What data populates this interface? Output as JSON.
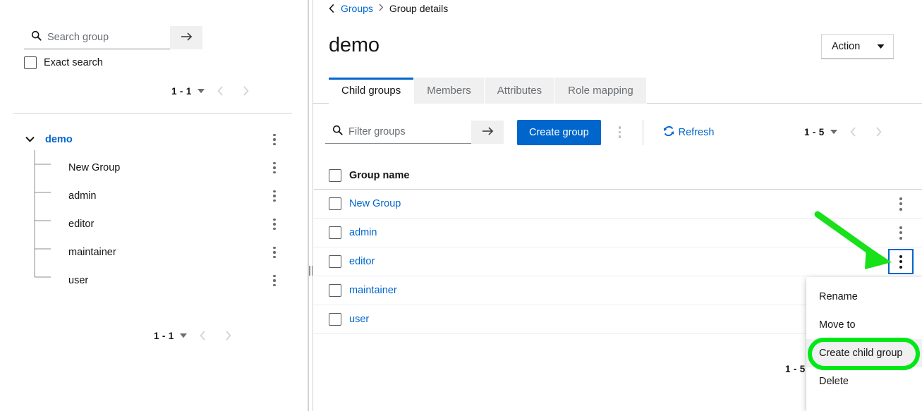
{
  "left_panel": {
    "search": {
      "placeholder": "Search group",
      "value": "",
      "go_label": "→",
      "icon": "search-icon"
    },
    "exact_search": {
      "label": "Exact search",
      "checked": false
    },
    "pager_top": {
      "count": "1 - 1"
    },
    "pager_bottom": {
      "count": "1 - 1"
    },
    "tree": [
      {
        "label": "demo",
        "level": 0,
        "expanded": true,
        "selected": true
      },
      {
        "label": "New Group",
        "level": 1
      },
      {
        "label": "admin",
        "level": 1
      },
      {
        "label": "editor",
        "level": 1
      },
      {
        "label": "maintainer",
        "level": 1
      },
      {
        "label": "user",
        "level": 1
      }
    ]
  },
  "right_panel": {
    "breadcrumb": {
      "back": "‹",
      "root": "Groups",
      "separator": "›",
      "current": "Group details"
    },
    "title": "demo",
    "action_button": {
      "label": "Action",
      "caret": "▼"
    },
    "tabs": [
      {
        "label": "Child groups",
        "active": true
      },
      {
        "label": "Members",
        "active": false
      },
      {
        "label": "Attributes",
        "active": false
      },
      {
        "label": "Role mapping",
        "active": false
      }
    ],
    "toolbar": {
      "filter": {
        "placeholder": "Filter groups",
        "value": "",
        "go_label": "→"
      },
      "create_group_label": "Create group",
      "refresh_label": "Refresh",
      "pager": {
        "count": "1 - 5"
      }
    },
    "table": {
      "columns": [
        "Group name"
      ],
      "rows": [
        {
          "name": "New Group"
        },
        {
          "name": "admin"
        },
        {
          "name": "editor"
        },
        {
          "name": "maintainer"
        },
        {
          "name": "user"
        }
      ]
    },
    "bottom_pager": {
      "count": "1 - 5"
    },
    "row_menu": {
      "open_for_row": "editor",
      "items": [
        {
          "label": "Rename",
          "hover": false
        },
        {
          "label": "Move to",
          "hover": false
        },
        {
          "label": "Create child group",
          "hover": true
        },
        {
          "label": "Delete",
          "hover": false
        }
      ]
    }
  },
  "annotations": {
    "arrow_color": "#18e019",
    "highlight_color": "#00e817",
    "focus_color": "#0066cc"
  },
  "colors": {
    "accent": "#0066cc",
    "link": "#0066cc",
    "text": "#151515",
    "muted": "#6a6e73",
    "border": "#d2d2d2",
    "row_border": "#ededed",
    "toolbar_bg": "#f0f0f0"
  }
}
